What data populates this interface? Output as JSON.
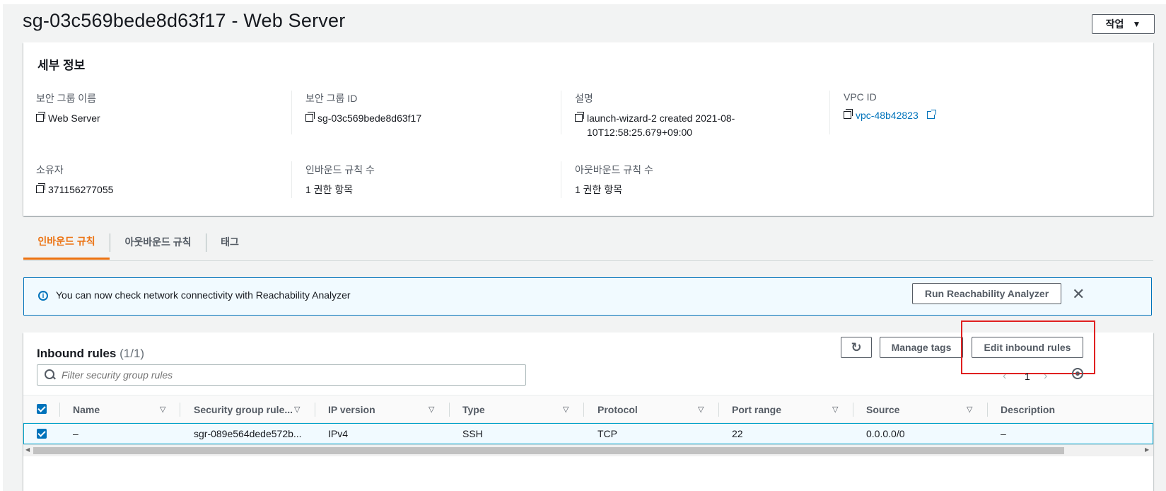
{
  "page": {
    "title": "sg-03c569bede8d63f17 - Web Server",
    "actions_label": "작업",
    "actions_caret": "▼"
  },
  "details": {
    "header": "세부 정보",
    "fields": {
      "sg_name": {
        "label": "보안 그룹 이름",
        "value": "Web Server"
      },
      "sg_id": {
        "label": "보안 그룹 ID",
        "value": "sg-03c569bede8d63f17"
      },
      "description": {
        "label": "설명",
        "value": "launch-wizard-2 created 2021-08-10T12:58:25.679+09:00"
      },
      "vpc_id": {
        "label": "VPC ID",
        "value": "vpc-48b42823"
      },
      "owner": {
        "label": "소유자",
        "value": "371156277055"
      },
      "inbound_count": {
        "label": "인바운드 규칙 수",
        "value": "1 권한 항목"
      },
      "outbound_count": {
        "label": "아웃바운드 규칙 수",
        "value": "1 권한 항목"
      }
    }
  },
  "tabs": {
    "inbound": "인바운드 규칙",
    "outbound": "아웃바운드 규칙",
    "tags": "태그"
  },
  "banner": {
    "text": "You can now check network connectivity with Reachability Analyzer",
    "button": "Run Reachability Analyzer",
    "close": "✕"
  },
  "rules": {
    "title": "Inbound rules",
    "count": "(1/1)",
    "refresh_icon": "↻",
    "manage_tags": "Manage tags",
    "edit_inbound": "Edit inbound rules",
    "filter_placeholder": "Filter security group rules",
    "pager_prev": "‹",
    "pager_page": "1",
    "pager_next": "›",
    "columns": [
      "Name",
      "Security group rule...",
      "IP version",
      "Type",
      "Protocol",
      "Port range",
      "Source",
      "Description"
    ],
    "rows": [
      {
        "name": "–",
        "rule_id": "sgr-089e564dede572b...",
        "ip_version": "IPv4",
        "type": "SSH",
        "protocol": "TCP",
        "port_range": "22",
        "source": "0.0.0.0/0",
        "description": "–"
      }
    ],
    "sort_caret": "▽",
    "scroll_left": "◀",
    "scroll_right": "▶"
  },
  "colors": {
    "accent_orange": "#ec7211",
    "link_blue": "#0073bb",
    "highlight_red": "#e02020"
  }
}
